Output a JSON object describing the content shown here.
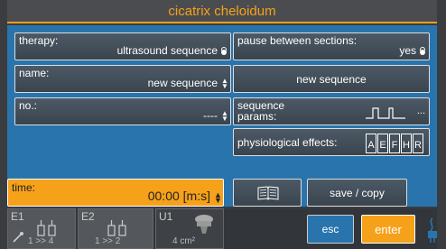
{
  "title": "cicatrix cheloidum",
  "therapy": {
    "label": "therapy:",
    "value": "ultrasound sequence"
  },
  "name": {
    "label": "name:",
    "value": "new sequence"
  },
  "no": {
    "label": "no.:",
    "value": "----"
  },
  "time": {
    "label": "time:",
    "value": "00:00 [m:s]"
  },
  "pause": {
    "label": "pause between sections:",
    "value": "yes"
  },
  "new_sequence_button": "new sequence",
  "sequence_params": {
    "label_line1": "sequence",
    "label_line2": "params:",
    "more": "..."
  },
  "physiological": {
    "label": "physiological effects:",
    "letters": [
      "A",
      "E",
      "F",
      "H",
      "R"
    ]
  },
  "save_copy": "save / copy",
  "electrodes": [
    {
      "tag": "E1",
      "sub": "1 >> 4"
    },
    {
      "tag": "E2",
      "sub": "1 >> 2"
    },
    {
      "tag": "U1",
      "sub": "4 cm²"
    }
  ],
  "esc": "esc",
  "enter": "enter",
  "colors": {
    "accent": "#f6a11a",
    "panel": "#2a74ad"
  }
}
